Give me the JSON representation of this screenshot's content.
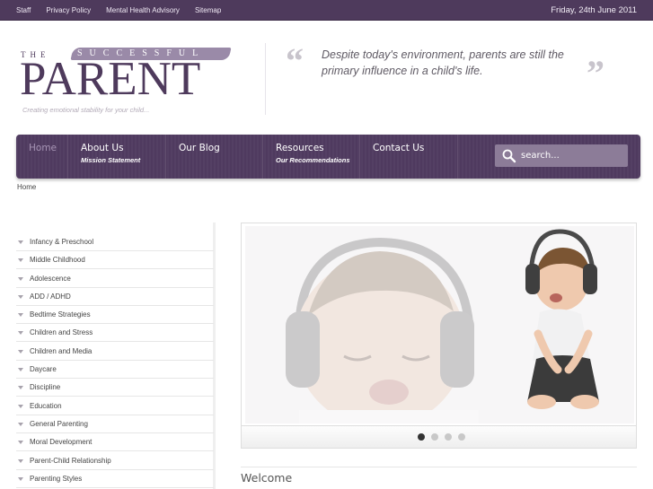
{
  "topbar": {
    "links": [
      "Staff",
      "Privacy Policy",
      "Mental Health Advisory",
      "Sitemap"
    ],
    "date": "Friday, 24th June 2011"
  },
  "logo": {
    "the": "THE",
    "successful": "SUCCESSFUL",
    "parent": "PARENT",
    "tagline": "Creating emotional stability for your child..."
  },
  "quote": {
    "open": "“",
    "text": "Despite today's environment, parents are still the primary influence in a child's life.",
    "close": "”"
  },
  "nav": {
    "items": [
      {
        "label": "Home",
        "sub": ""
      },
      {
        "label": "About Us",
        "sub": "Mission Statement"
      },
      {
        "label": "Our Blog",
        "sub": ""
      },
      {
        "label": "Resources",
        "sub": "Our Recommendations"
      },
      {
        "label": "Contact Us",
        "sub": ""
      }
    ],
    "search_placeholder": "search..."
  },
  "breadcrumb": "Home",
  "sidebar": {
    "items": [
      {
        "label": "Infancy & Preschool"
      },
      {
        "label": "Middle Childhood"
      },
      {
        "label": "Adolescence"
      },
      {
        "label": "ADD / ADHD"
      },
      {
        "label": "Bedtime Strategies"
      },
      {
        "label": "Children and Stress"
      },
      {
        "label": "Children and Media"
      },
      {
        "label": "Daycare"
      },
      {
        "label": "Discipline"
      },
      {
        "label": "Education"
      },
      {
        "label": "General Parenting"
      },
      {
        "label": "Moral Development"
      },
      {
        "label": "Parent-Child Relationship"
      },
      {
        "label": "Parenting Styles"
      }
    ]
  },
  "slider": {
    "slide_count": 4,
    "active_index": 0,
    "image": "child-with-headphones"
  },
  "welcome": "Welcome",
  "colors": {
    "brand_purple": "#4e3a5c",
    "nav_bg": "#4f3a5f",
    "search_bg": "#8c7c98",
    "quote_grey": "#c8c4cc"
  }
}
